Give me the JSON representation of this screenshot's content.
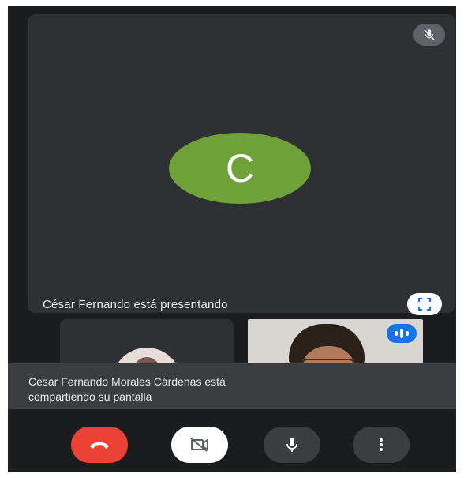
{
  "main_tile": {
    "avatar_letter": "C",
    "avatar_color": "#6fa13a",
    "presenting_text": "César Fernando está presentando",
    "mute_icon": "mic-off-icon",
    "fullscreen_icon": "fullscreen-icon"
  },
  "toast": {
    "line1": "César Fernando Morales Cárdenas está",
    "line2": "compartiendo su pantalla"
  },
  "controls": {
    "end_call_icon": "phone-hangup-icon",
    "camera_icon": "camera-off-icon",
    "mic_icon": "mic-icon",
    "more_icon": "more-vert-icon",
    "end_call_color": "#ea4335"
  },
  "participants": {
    "speaking_icon": "audio-level-icon",
    "speaking_color": "#1a73e8"
  }
}
